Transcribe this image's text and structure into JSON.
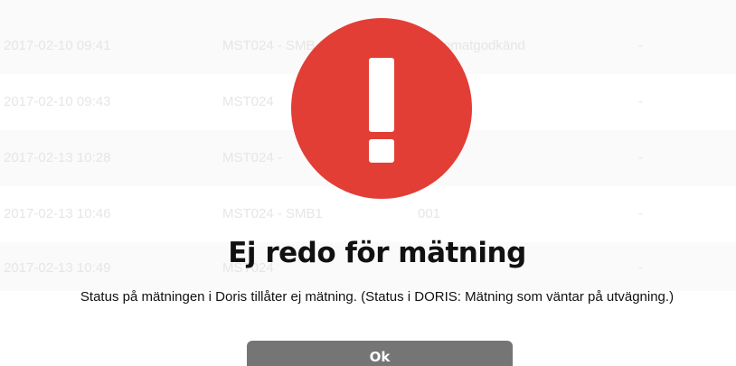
{
  "background_table": {
    "rows": [
      {
        "date": "2017-02-10 09:41",
        "id": "MST024 - SMB",
        "status": "omatgodkänd",
        "extra": "-"
      },
      {
        "date": "2017-02-10 09:43",
        "id": "MST024",
        "status": "",
        "extra": "-"
      },
      {
        "date": "2017-02-13 10:28",
        "id": "MST024 -",
        "status": "",
        "extra": "-"
      },
      {
        "date": "2017-02-13 10:46",
        "id": "MST024 - SMB1",
        "status": "001",
        "extra": "-"
      },
      {
        "date": "2017-02-13 10:49",
        "id": "MST024",
        "status": "",
        "extra": "-"
      }
    ]
  },
  "dialog": {
    "icon": "exclamation-icon",
    "accent_color": "#e23e35",
    "title": "Ej redo för mätning",
    "message": "Status på mätningen i Doris tillåter ej mätning. (Status i DORIS: Mätning som väntar på utvägning.)",
    "ok_label": "Ok"
  }
}
